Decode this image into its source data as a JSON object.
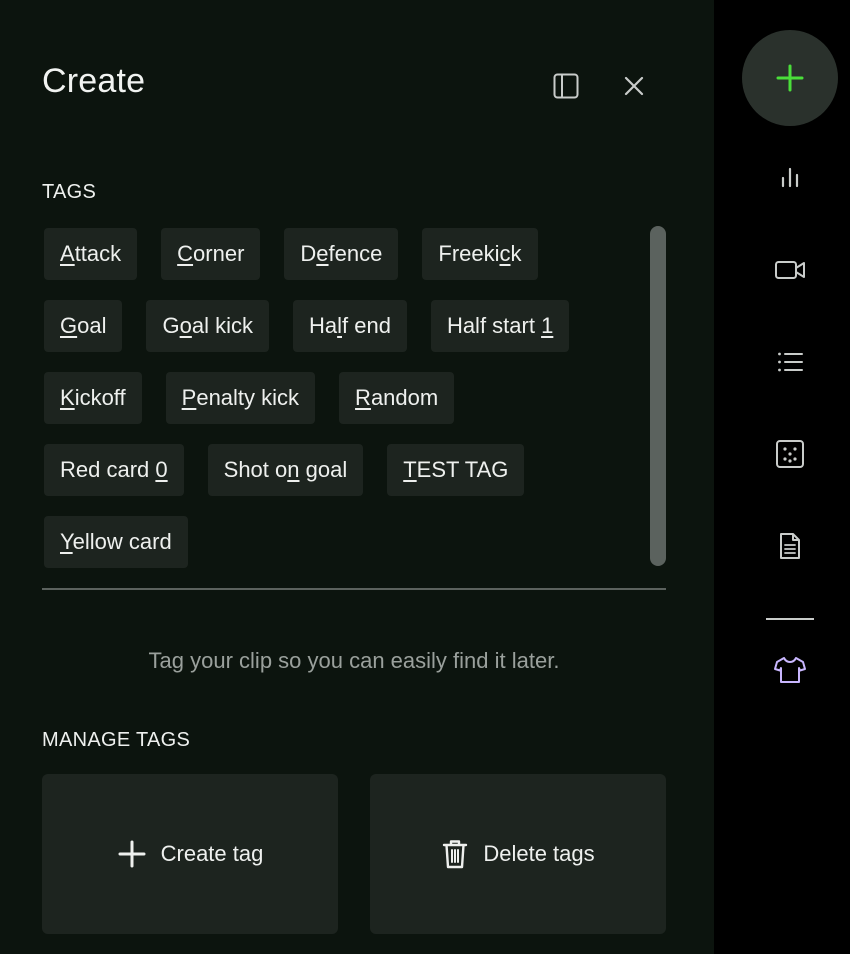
{
  "panel": {
    "title": "Create",
    "tags_label": "TAGS",
    "tags": [
      [
        {
          "pre": "",
          "u": "A",
          "post": "ttack"
        },
        {
          "pre": "",
          "u": "C",
          "post": "orner"
        },
        {
          "pre": "D",
          "u": "e",
          "post": "fence"
        },
        {
          "pre": "Freeki",
          "u": "c",
          "post": "k"
        }
      ],
      [
        {
          "pre": "",
          "u": "G",
          "post": "oal"
        },
        {
          "pre": "G",
          "u": "o",
          "post": "al kick"
        },
        {
          "pre": "Ha",
          "u": "l",
          "post": "f end"
        },
        {
          "pre": "Half start ",
          "u": "1",
          "post": ""
        }
      ],
      [
        {
          "pre": "",
          "u": "K",
          "post": "ickoff"
        },
        {
          "pre": "",
          "u": "P",
          "post": "enalty kick"
        },
        {
          "pre": "",
          "u": "R",
          "post": "andom"
        }
      ],
      [
        {
          "pre": "Red card ",
          "u": "0",
          "post": ""
        },
        {
          "pre": "Shot o",
          "u": "n",
          "post": " goal"
        },
        {
          "pre": "",
          "u": "T",
          "post": "EST TAG"
        }
      ],
      [
        {
          "pre": "",
          "u": "Y",
          "post": "ellow card"
        }
      ]
    ],
    "hint": "Tag your clip so you can easily find it later.",
    "manage_label": "MANAGE TAGS",
    "create_tag_label": "Create tag",
    "delete_tags_label": "Delete tags"
  },
  "icons": {
    "sidebar_toggle": "sidebar-toggle-icon",
    "close": "close-icon",
    "fab": "plus-icon",
    "rail": [
      "bar-chart-icon",
      "video-camera-icon",
      "list-icon",
      "dice-icon",
      "document-icon",
      "tshirt-icon"
    ]
  },
  "colors": {
    "panel_bg": "#0c140e",
    "tag_bg": "#1d241f",
    "accent_green": "#4ade3a",
    "accent_purple": "#c9b7ff"
  }
}
